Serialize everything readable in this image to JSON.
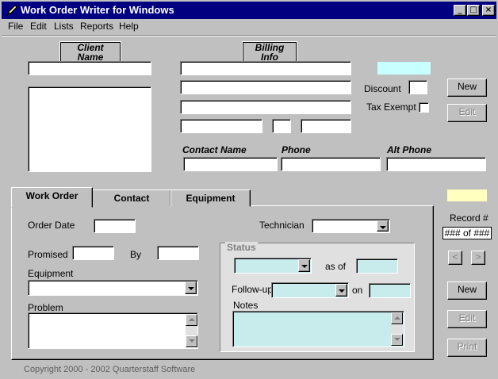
{
  "window": {
    "title": "Work Order Writer for Windows",
    "controls": {
      "minimize": "_",
      "maximize": "□",
      "close": "×"
    }
  },
  "menu": [
    "File",
    "Edit",
    "Lists",
    "Reports",
    "Help"
  ],
  "client": {
    "header": "Client Name"
  },
  "billing": {
    "header": "Billing Info"
  },
  "right_panel": {
    "discount_label": "Discount",
    "tax_exempt_label": "Tax Exempt",
    "new_label": "New",
    "edit_label": "Edit"
  },
  "contact_headers": {
    "contact_name": "Contact Name",
    "phone": "Phone",
    "alt_phone": "Alt Phone"
  },
  "tabs": [
    "Work Order",
    "Contact",
    "Equipment"
  ],
  "work_order": {
    "order_date_label": "Order Date",
    "technician_label": "Technician",
    "promised_label": "Promised",
    "by_label": "By",
    "equipment_label": "Equipment",
    "problem_label": "Problem"
  },
  "status": {
    "title": "Status",
    "as_of_label": "as of",
    "follow_up_label": "Follow-up",
    "on_label": "on",
    "notes_label": "Notes"
  },
  "record": {
    "label": "Record #",
    "value": "### of ###",
    "prev": "<",
    "next": ">",
    "new_label": "New",
    "edit_label": "Edit",
    "print_label": "Print"
  },
  "footer": {
    "copyright": "Copyright 2000 - 2002  Quarterstaff Software"
  },
  "colors": {
    "titlebar": "#000080",
    "cyan_swatch": "#c8ffff",
    "yellow_swatch": "#ffffc0",
    "status_fields": "#c8ecec"
  }
}
